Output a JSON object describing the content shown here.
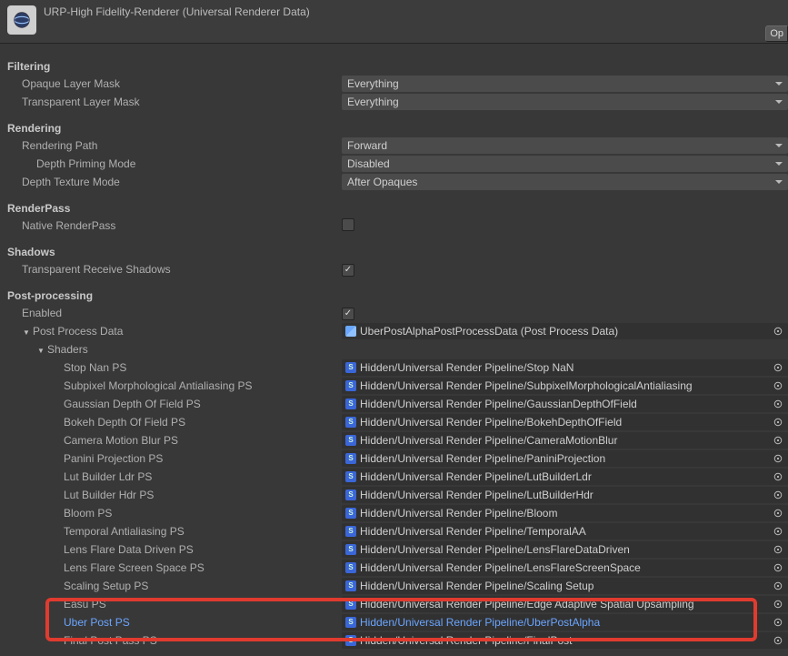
{
  "title": "URP-High Fidelity-Renderer (Universal Renderer Data)",
  "opBtn": "Op",
  "sections": {
    "filtering": "Filtering",
    "rendering": "Rendering",
    "renderpass": "RenderPass",
    "shadows": "Shadows",
    "postprocessing": "Post-processing"
  },
  "labels": {
    "opaqueLayerMask": "Opaque Layer Mask",
    "transparentLayerMask": "Transparent Layer Mask",
    "renderingPath": "Rendering Path",
    "depthPrimingMode": "Depth Priming Mode",
    "depthTextureMode": "Depth Texture Mode",
    "nativeRenderPass": "Native RenderPass",
    "transparentReceiveShadows": "Transparent Receive Shadows",
    "enabled": "Enabled",
    "postProcessData": "Post Process Data",
    "shaders": "Shaders"
  },
  "values": {
    "opaqueLayerMask": "Everything",
    "transparentLayerMask": "Everything",
    "renderingPath": "Forward",
    "depthPrimingMode": "Disabled",
    "depthTextureMode": "After Opaques",
    "postProcessData": "UberPostAlphaPostProcessData (Post Process Data)"
  },
  "shaders": [
    {
      "label": "Stop Nan PS",
      "value": "Hidden/Universal Render Pipeline/Stop NaN"
    },
    {
      "label": "Subpixel Morphological Antialiasing PS",
      "value": "Hidden/Universal Render Pipeline/SubpixelMorphologicalAntialiasing"
    },
    {
      "label": "Gaussian Depth Of Field PS",
      "value": "Hidden/Universal Render Pipeline/GaussianDepthOfField"
    },
    {
      "label": "Bokeh Depth Of Field PS",
      "value": "Hidden/Universal Render Pipeline/BokehDepthOfField"
    },
    {
      "label": "Camera Motion Blur PS",
      "value": "Hidden/Universal Render Pipeline/CameraMotionBlur"
    },
    {
      "label": "Panini Projection PS",
      "value": "Hidden/Universal Render Pipeline/PaniniProjection"
    },
    {
      "label": "Lut Builder Ldr PS",
      "value": "Hidden/Universal Render Pipeline/LutBuilderLdr"
    },
    {
      "label": "Lut Builder Hdr PS",
      "value": "Hidden/Universal Render Pipeline/LutBuilderHdr"
    },
    {
      "label": "Bloom PS",
      "value": "Hidden/Universal Render Pipeline/Bloom"
    },
    {
      "label": "Temporal Antialiasing PS",
      "value": "Hidden/Universal Render Pipeline/TemporalAA"
    },
    {
      "label": "Lens Flare Data Driven PS",
      "value": "Hidden/Universal Render Pipeline/LensFlareDataDriven"
    },
    {
      "label": "Lens Flare Screen Space PS",
      "value": "Hidden/Universal Render Pipeline/LensFlareScreenSpace"
    },
    {
      "label": "Scaling Setup PS",
      "value": "Hidden/Universal Render Pipeline/Scaling Setup"
    },
    {
      "label": "Easu PS",
      "value": "Hidden/Universal Render Pipeline/Edge Adaptive Spatial Upsampling"
    },
    {
      "label": "Uber Post PS",
      "value": "Hidden/Universal Render Pipeline/UberPostAlpha",
      "highlight": true
    },
    {
      "label": "Final Post Pass PS",
      "value": "Hidden/Universal Render Pipeline/FinalPost"
    }
  ]
}
